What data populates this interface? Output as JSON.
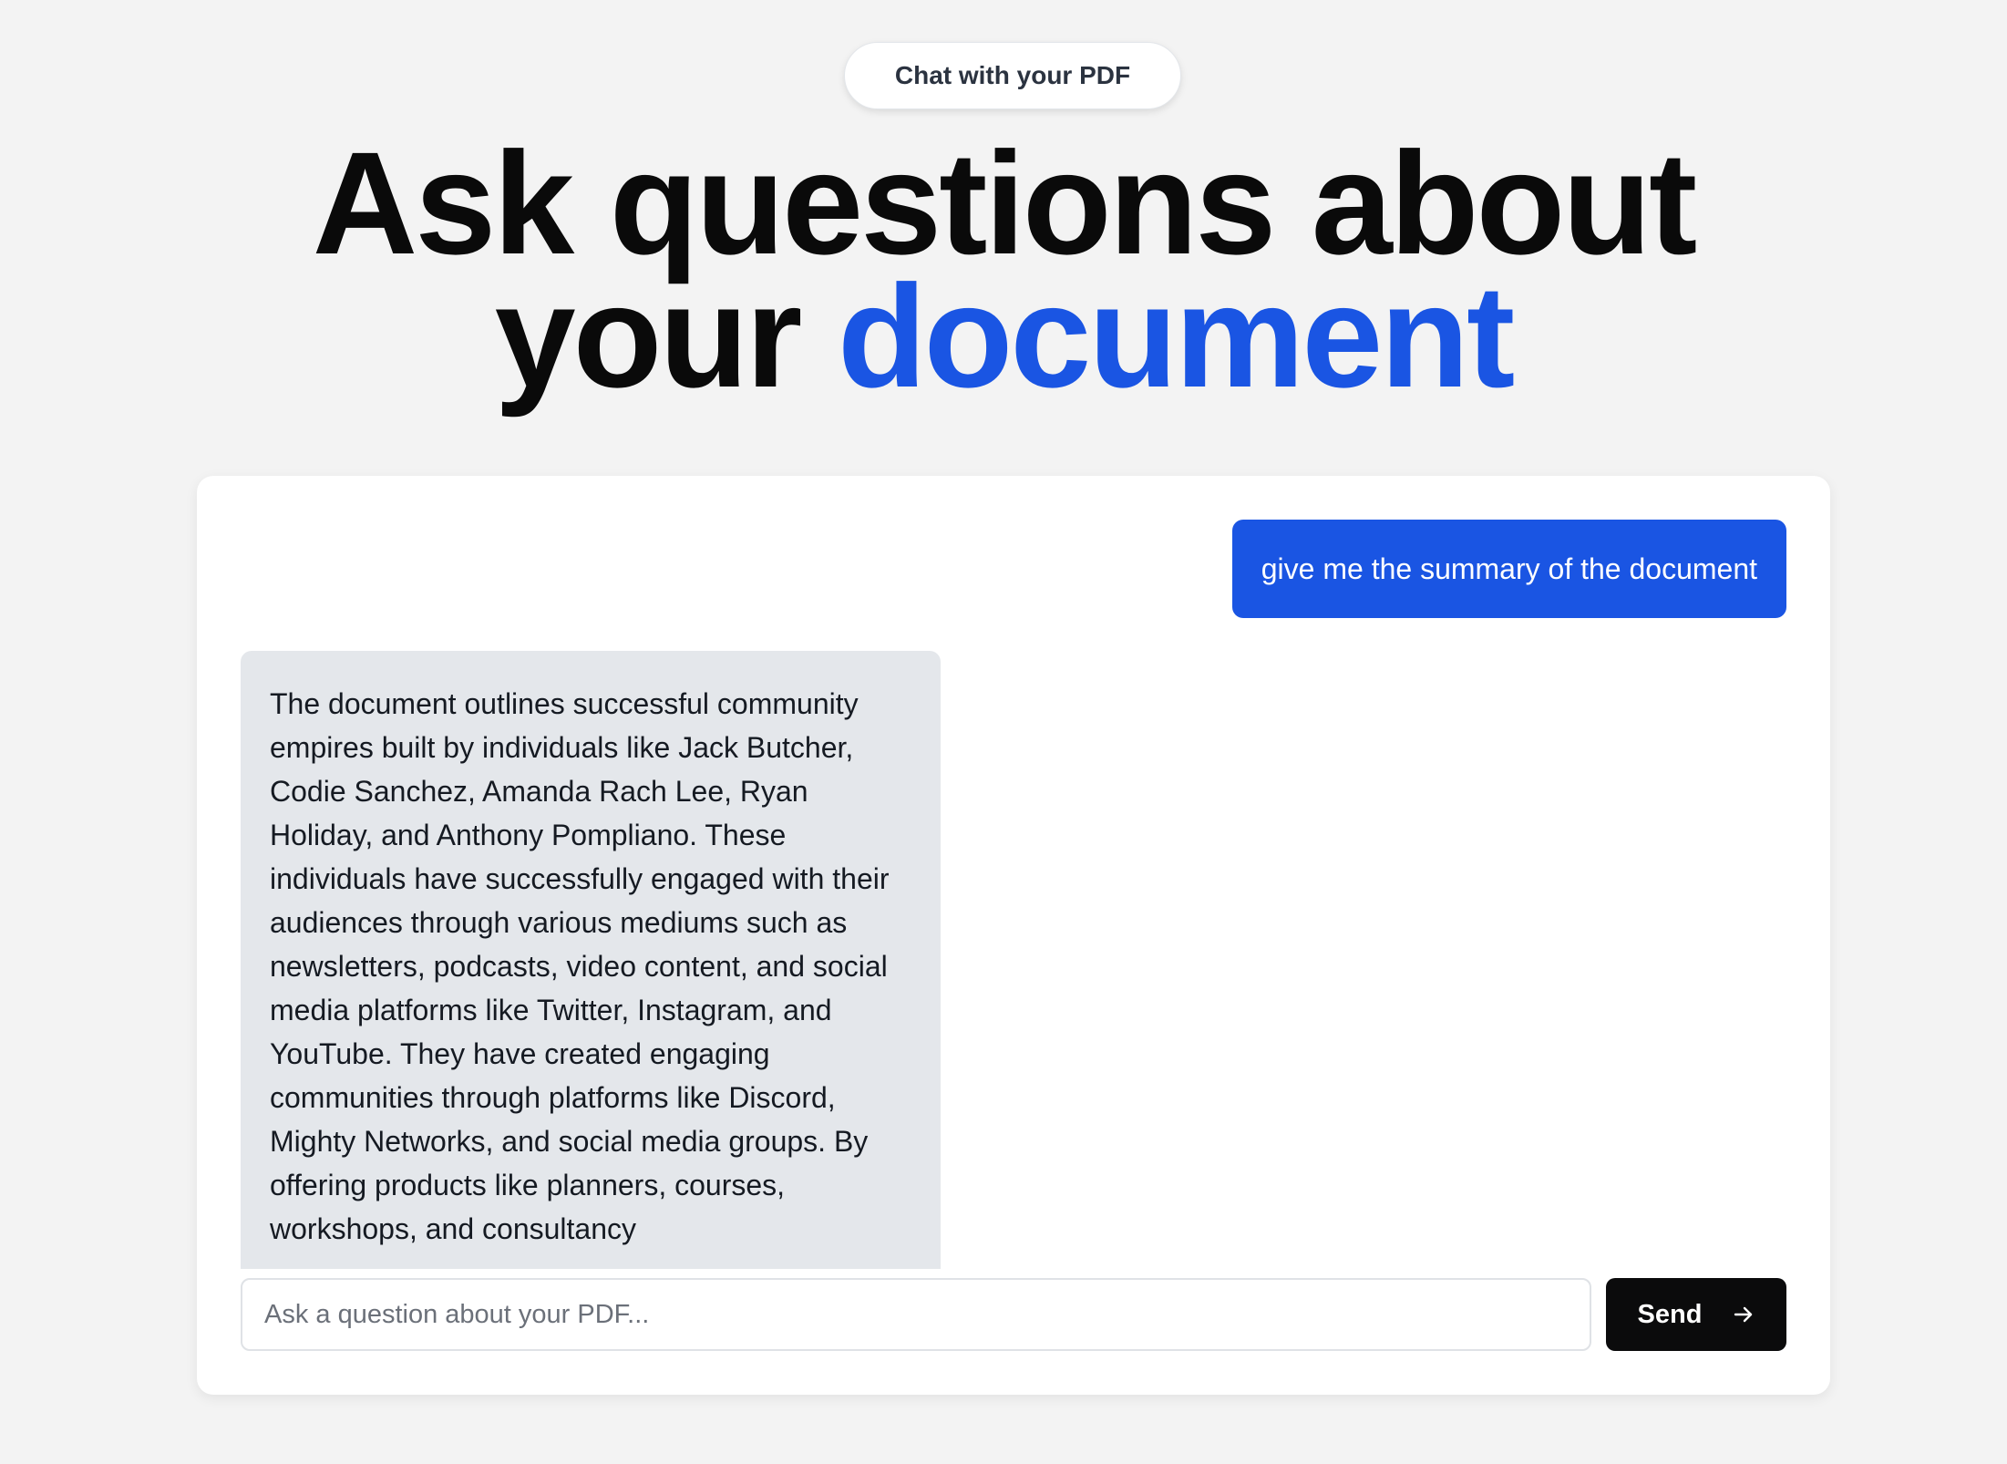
{
  "header": {
    "pill_label": "Chat with your PDF",
    "headline_line1": "Ask questions about",
    "headline_line2_prefix": "your ",
    "headline_accent": "document"
  },
  "chat": {
    "messages": [
      {
        "role": "user",
        "text": "give me the summary of the document"
      },
      {
        "role": "assistant",
        "text": "The document outlines successful community empires built by individuals like Jack Butcher, Codie Sanchez, Amanda Rach Lee, Ryan Holiday, and Anthony Pompliano. These individuals have successfully engaged with their audiences through various mediums such as newsletters, podcasts, video content, and social media platforms like Twitter, Instagram, and YouTube. They have created engaging communities through platforms like Discord, Mighty Networks, and social media groups. By offering products like planners, courses, workshops, and consultancy"
      }
    ]
  },
  "composer": {
    "placeholder": "Ask a question about your PDF...",
    "value": "",
    "send_label": "Send",
    "send_icon": "arrow-right-icon"
  },
  "colors": {
    "accent": "#1a55e3",
    "assistant_bubble": "#e4e7eb",
    "send_button": "#0b0b0c",
    "background": "#f3f3f3"
  }
}
